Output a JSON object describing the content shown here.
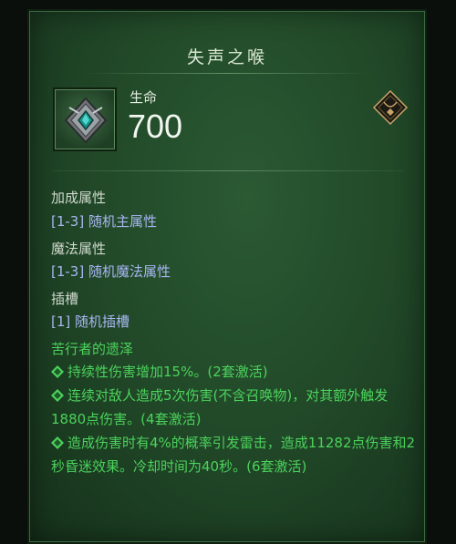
{
  "item": {
    "name": "失声之喉",
    "life_label": "生命",
    "life_value": "700"
  },
  "sections": {
    "bonus_head": "加成属性",
    "bonus_value": "[1-3] 随机主属性",
    "magic_head": "魔法属性",
    "magic_value": "[1-3] 随机魔法属性",
    "socket_head": "插槽",
    "socket_value": "[1] 随机插槽"
  },
  "set": {
    "name": "苦行者的遗泽",
    "bonuses": [
      "持续性伤害增加15%。(2套激活)",
      "连续对敌人造成5次伤害(不含召唤物)，对其额外触发1880点伤害。(4套激活)",
      "造成伤害时有4%的概率引发雷击，造成11282点伤害和2秒昏迷效果。冷却时间为40秒。(6套激活)"
    ]
  },
  "colors": {
    "panel_green": "#224a29",
    "set_green": "#4bd25c",
    "magic_blue": "#a8b6f2",
    "gold_accent": "#c9a569"
  },
  "icons": {
    "item": "necklace-icon",
    "slot": "amulet-slot-icon",
    "bullet": "set-bullet-icon"
  }
}
